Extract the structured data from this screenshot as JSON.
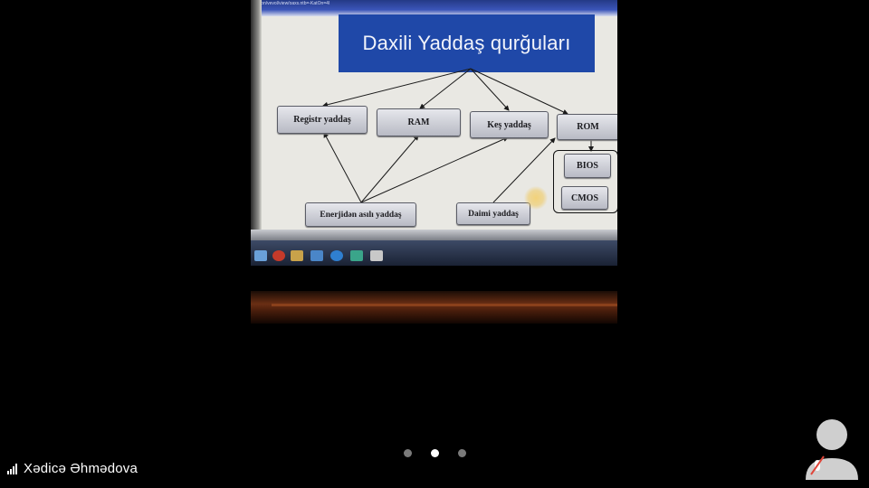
{
  "slide": {
    "title": "Daxili Yaddaş qurğuları",
    "url_text": "..ichon/vevol/view/oaxs.ntb=-KatOn=4l"
  },
  "diagram": {
    "nodes": {
      "registr": "Registr yaddaş",
      "ram": "RAM",
      "kes": "Keş yaddaş",
      "rom": "ROM",
      "bios": "BIOS",
      "cmos": "CMOS",
      "enerji": "Enerjidən asılı yaddaş",
      "daimi": "Daimi yaddaş"
    }
  },
  "call": {
    "caller_name": "Xədicə Əhmədova",
    "pages": 3,
    "active_page": 1
  },
  "colors": {
    "title_bg": "#1f48a8",
    "slide_bg": "#e9e8e3",
    "node_fill": "#c8cad2"
  },
  "icons": {
    "signal": "signal-strength-icon",
    "avatar": "user-avatar-icon",
    "muted": "microphone-off-icon"
  }
}
